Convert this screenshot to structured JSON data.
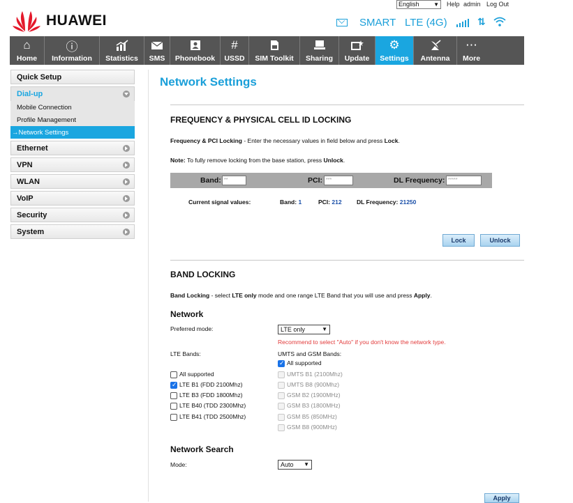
{
  "topbar": {
    "language": "English",
    "help": "Help",
    "admin": "admin",
    "logout": "Log Out"
  },
  "brand": {
    "name": "HUAWEI",
    "logo_icon": "huawei-logo-icon"
  },
  "status": {
    "carrier": "SMART",
    "network_type": "LTE (4G)",
    "signal_bars": 4,
    "accent_color": "#1a9fd9"
  },
  "nav": [
    {
      "label": "Home",
      "icon": "home-icon",
      "glyph": "⌂"
    },
    {
      "label": "Information",
      "icon": "info-icon",
      "glyph": "ⓘ"
    },
    {
      "label": "Statistics",
      "icon": "statistics-icon",
      "glyph": "📈"
    },
    {
      "label": "SMS",
      "icon": "envelope-icon",
      "glyph": "✉"
    },
    {
      "label": "Phonebook",
      "icon": "phonebook-icon",
      "glyph": "☎"
    },
    {
      "label": "USSD",
      "icon": "hash-icon",
      "glyph": "#"
    },
    {
      "label": "SIM Toolkit",
      "icon": "sim-icon",
      "glyph": "▤"
    },
    {
      "label": "Sharing",
      "icon": "sharing-icon",
      "glyph": "🖥"
    },
    {
      "label": "Update",
      "icon": "update-icon",
      "glyph": "▭"
    },
    {
      "label": "Settings",
      "icon": "gear-icon",
      "glyph": "⚙"
    },
    {
      "label": "Antenna",
      "icon": "antenna-icon",
      "glyph": "📡"
    },
    {
      "label": "More",
      "icon": "more-icon",
      "glyph": "⋯"
    }
  ],
  "sidebar": {
    "quick_setup": "Quick Setup",
    "dialup": "Dial-up",
    "dialup_items": [
      "Mobile Connection",
      "Profile Management",
      "→Network Settings"
    ],
    "sections": [
      "Ethernet",
      "VPN",
      "WLAN",
      "VoIP",
      "Security",
      "System"
    ]
  },
  "page": {
    "title": "Network Settings"
  },
  "pci": {
    "title": "FREQUENCY & PHYSICAL CELL ID LOCKING",
    "intro_bold": "Frequency & PCI Locking",
    "intro_text": " - Enter the necessary values in field below and press ",
    "intro_lock": "Lock",
    "note_bold": "Note:",
    "note_text": " To fully remove locking from the base station, press ",
    "note_unlock": "Unlock",
    "band_label": "Band:",
    "band_placeholder": "**",
    "pci_label": "PCI:",
    "pci_placeholder": "***",
    "dl_label": "DL Frequency:",
    "dl_placeholder": "*****",
    "current_label": "Current signal values:",
    "cur_band_label": "Band:",
    "cur_band_value": "1",
    "cur_pci_label": "PCI:",
    "cur_pci_value": "212",
    "cur_dl_label": "DL Frequency:",
    "cur_dl_value": "21250",
    "lock_button": "Lock",
    "unlock_button": "Unlock"
  },
  "band": {
    "title": "BAND LOCKING",
    "intro_bold": "Band Locking",
    "intro_text1": " - select ",
    "intro_lte": "LTE only",
    "intro_text2": " mode and one range LTE Band that you will use and press ",
    "intro_apply": "Apply",
    "network_heading": "Network",
    "preferred_label": "Preferred mode:",
    "preferred_value": "LTE only",
    "warning": "Recommend to select \"Auto\" if you don't know the network type.",
    "lte_label": "LTE Bands:",
    "umts_label": "UMTS and GSM Bands:",
    "lte_bands": [
      {
        "label": "All supported",
        "checked": false
      },
      {
        "label": "LTE B1 (FDD 2100Mhz)",
        "checked": true
      },
      {
        "label": "LTE B3 (FDD 1800Mhz)",
        "checked": false
      },
      {
        "label": "LTE B40 (TDD 2300Mhz)",
        "checked": false
      },
      {
        "label": "LTE B41 (TDD 2500Mhz)",
        "checked": false
      }
    ],
    "umts_bands": [
      {
        "label": "All supported",
        "checked": true,
        "disabled": false
      },
      {
        "label": "UMTS B1 (2100Mhz)",
        "checked": false,
        "disabled": true
      },
      {
        "label": "UMTS B8 (900Mhz)",
        "checked": false,
        "disabled": true
      },
      {
        "label": "GSM B2 (1900MHz)",
        "checked": false,
        "disabled": true
      },
      {
        "label": "GSM B3 (1800MHz)",
        "checked": false,
        "disabled": true
      },
      {
        "label": "GSM B5 (850MHz)",
        "checked": false,
        "disabled": true
      },
      {
        "label": "GSM B8 (900MHz)",
        "checked": false,
        "disabled": true
      }
    ],
    "search_heading": "Network Search",
    "mode_label": "Mode:",
    "mode_value": "Auto",
    "apply_button": "Apply"
  }
}
